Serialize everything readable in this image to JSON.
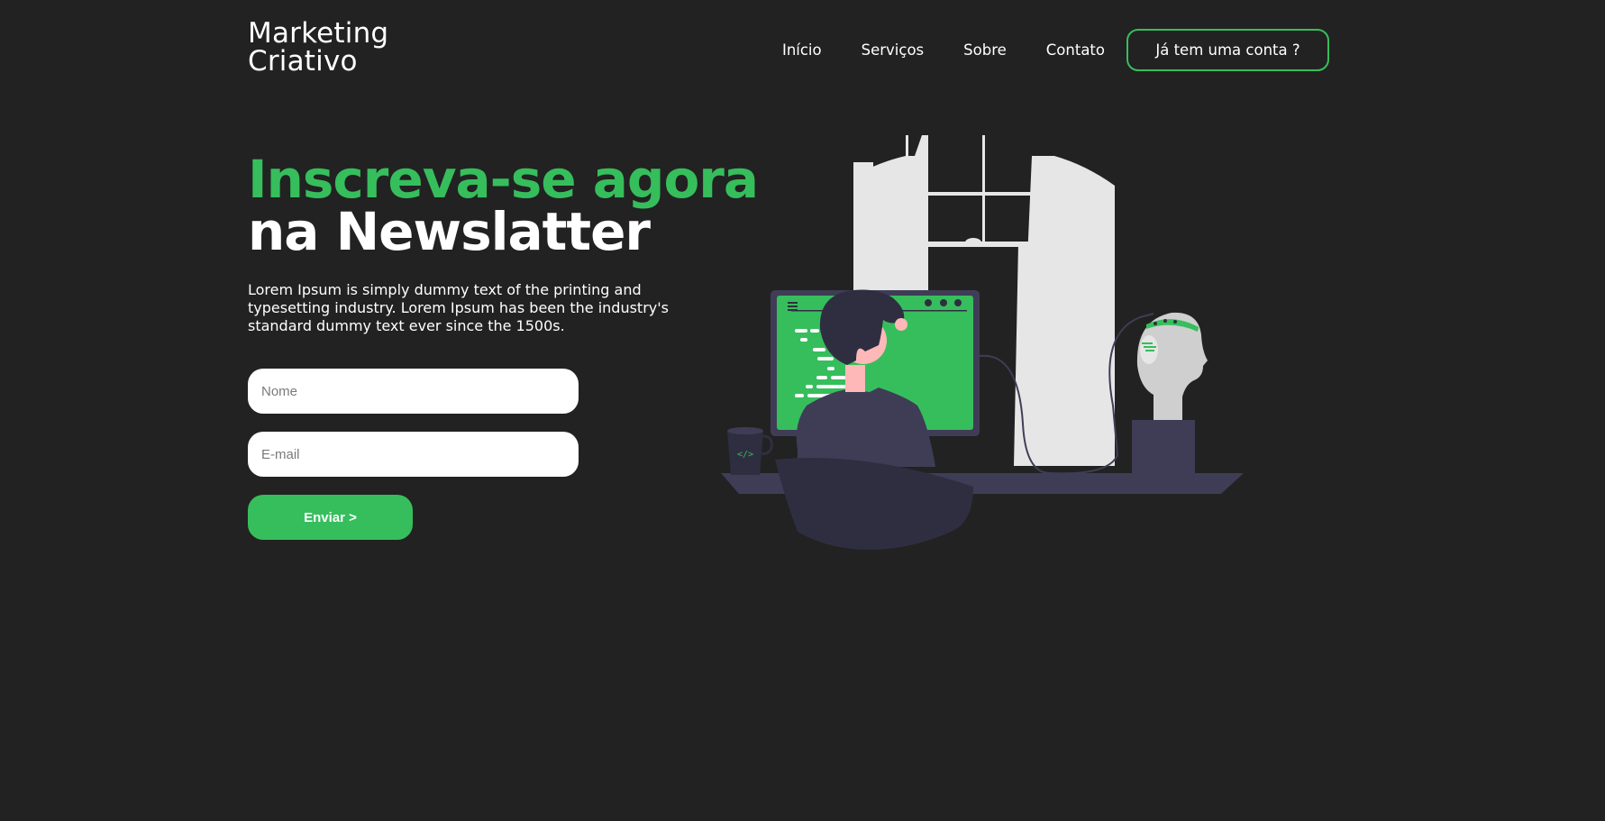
{
  "header": {
    "logo_line1": "Marketing",
    "logo_line2": "Criativo",
    "nav": [
      "Início",
      "Serviços",
      "Sobre",
      "Contato"
    ],
    "login_label": "Já tem uma conta ?"
  },
  "hero": {
    "title_green": "Inscreva-se agora",
    "title_white": "na Newslatter",
    "description": "Lorem Ipsum is simply dummy text of the printing and typesetting industry. Lorem Ipsum has been the industry's standard dummy text ever since the 1500s.",
    "name_placeholder": "Nome",
    "email_placeholder": "E-mail",
    "submit_label": "Enviar >",
    "mug_label": "</>"
  },
  "colors": {
    "background": "#222222",
    "accent": "#36be5c",
    "text": "#ffffff",
    "dark_figure": "#2f2e41",
    "light_figure": "#e6e6e6"
  }
}
